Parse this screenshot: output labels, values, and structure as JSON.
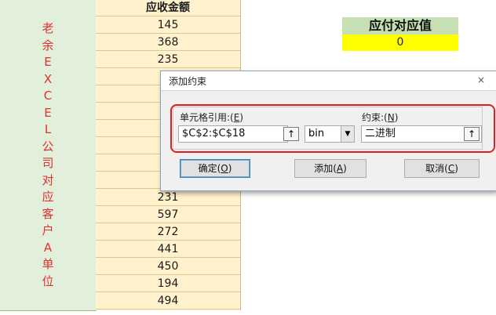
{
  "sheet": {
    "left_vertical_text": [
      "老",
      "余",
      "E",
      "X",
      "C",
      "E",
      "L",
      "公",
      "司",
      "对",
      "应",
      "客",
      "户",
      "A",
      "单",
      "位"
    ],
    "amount_header": "应收金额",
    "amounts": [
      "145",
      "368",
      "235",
      "",
      "",
      "",
      "",
      "",
      "",
      "",
      "231",
      "597",
      "272",
      "441",
      "450",
      "194",
      "494"
    ],
    "target_label": "应付对应值",
    "target_value": "0"
  },
  "dialog": {
    "title": "添加约束",
    "close_symbol": "×",
    "cell_ref_label": "单元格引用:",
    "cell_ref_key": "E",
    "cell_ref_value": "$C$2:$C$18",
    "operator_value": "bin",
    "constraint_label": "约束:",
    "constraint_key": "N",
    "constraint_value": "二进制",
    "ok_label": "确定",
    "ok_key": "O",
    "add_label": "添加",
    "add_key": "A",
    "cancel_label": "取消",
    "cancel_key": "C"
  },
  "icons": {
    "collapse": "↑",
    "dropdown": "▼"
  },
  "colors": {
    "left_column_bg": "#e2efda",
    "amount_column_bg": "#fff2cc",
    "target_label_bg": "#c6e0b4",
    "target_value_bg": "#ffff00",
    "highlight_frame": "#e02020",
    "vertical_text": "#e03030"
  }
}
